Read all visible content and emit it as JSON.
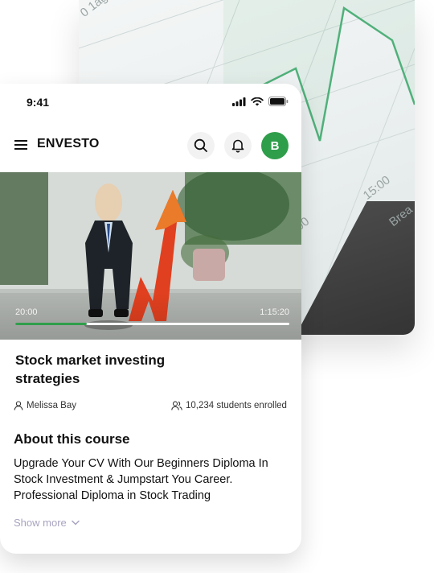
{
  "status_bar": {
    "time": "9:41"
  },
  "app_bar": {
    "brand": "ENVESTO",
    "avatar_initial": "B"
  },
  "video": {
    "current_time": "20:00",
    "total_time": "1:15:20",
    "progress": 0.26
  },
  "course": {
    "title": "Stock market investing strategies",
    "author": "Melissa Bay",
    "enrolled": "10,234 students enrolled"
  },
  "about": {
    "heading": "About this course",
    "description": "Upgrade Your CV With Our Beginners Diploma In Stock Investment & Jumpstart You Career. Professional Diploma in Stock Trading",
    "show_more": "Show more"
  },
  "background": {
    "chart_labels": [
      "0 1ag",
      "15:00",
      "00",
      "Brea"
    ]
  },
  "colors": {
    "accent": "#2f9e4b",
    "muted": "#a9a3c0"
  }
}
